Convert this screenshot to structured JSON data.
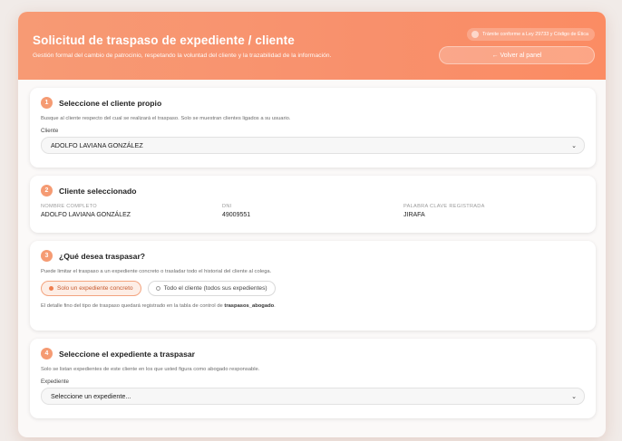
{
  "header": {
    "title": "Solicitud de traspaso de expediente / cliente",
    "subtitle": "Gestión formal del cambio de patrocinio, respetando la voluntad del cliente y la trazabilidad de la información.",
    "badge": "Trámite conforme a Ley 29733 y Código de Ética",
    "back_label": "← Volver al panel"
  },
  "step1": {
    "number": "1",
    "title": "Seleccione el cliente propio",
    "help": "Busque al cliente respecto del cual se realizará el traspaso. Solo se muestran clientes ligados a su usuario.",
    "field_label": "Cliente",
    "value": "ADOLFO LAVIANA GONZÁLEZ"
  },
  "step2": {
    "number": "2",
    "title": "Cliente seleccionado",
    "columns": [
      {
        "label": "NOMBRE COMPLETO",
        "value": "ADOLFO LAVIANA GONZÁLEZ"
      },
      {
        "label": "DNI",
        "value": "49009551"
      },
      {
        "label": "PALABRA CLAVE REGISTRADA",
        "value": "JIRAFA"
      }
    ]
  },
  "step3": {
    "number": "3",
    "title": "¿Qué desea traspasar?",
    "help": "Puede limitar el traspaso a un expediente concreto o trasladar todo el historial del cliente al colega.",
    "options": [
      {
        "label": "Solo un expediente concreto",
        "selected": true
      },
      {
        "label": "Todo el cliente (todos sus expedientes)",
        "selected": false
      }
    ],
    "note_prefix": "El detalle fino del tipo de traspaso quedará registrado en la tabla de control de ",
    "note_table": "traspasos_abogado",
    "note_suffix": "."
  },
  "step4": {
    "number": "4",
    "title": "Seleccione el expediente a traspasar",
    "help": "Solo se listan expedientes de este cliente en los que usted figura como abogado responsable.",
    "field_label": "Expediente",
    "value": "Seleccione un expediente..."
  },
  "colors": {
    "accent": "#f59b73",
    "accent_dark": "#ef7f4f"
  }
}
